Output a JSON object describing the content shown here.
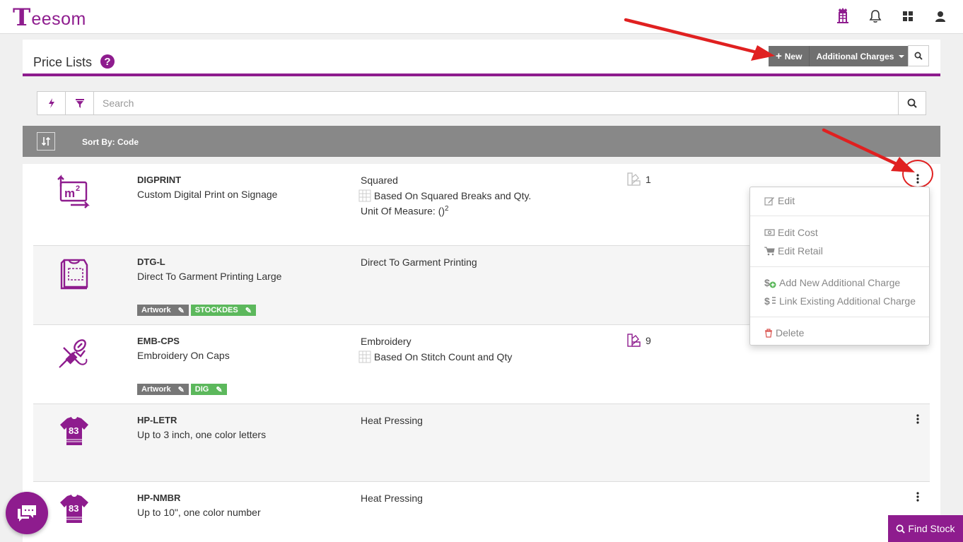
{
  "brand": {
    "logo_initial": "T",
    "logo_rest": "eesom",
    "accent_color": "#8e1c8e"
  },
  "nav": {
    "icons": [
      "castle-icon",
      "bell-icon",
      "grid-icon",
      "user-icon"
    ]
  },
  "header": {
    "title": "Price Lists",
    "help": "?",
    "new_label": "New",
    "charges_label": "Additional Charges"
  },
  "search": {
    "placeholder": "Search"
  },
  "sort": {
    "label": "Sort By: Code"
  },
  "rows": [
    {
      "code": "DIGPRINT",
      "description": "Custom Digital Print on Signage",
      "type": "Squared",
      "basis": "Based On Squared Breaks and Qty.",
      "uom_prefix": "Unit Of Measure: ()",
      "uom_sup": "2",
      "count": "1",
      "icon": "square-meter-icon"
    },
    {
      "code": "DTG-L",
      "description": "Direct To Garment Printing Large",
      "type": "Direct To Garment Printing",
      "tags": [
        "Artwork",
        "STOCKDES"
      ],
      "icon": "garment-print-icon"
    },
    {
      "code": "EMB-CPS",
      "description": "Embroidery On Caps",
      "type": "Embroidery",
      "basis": "Based On Stitch Count and Qty",
      "count": "9",
      "tags": [
        "Artwork",
        "DIG"
      ],
      "icon": "embroidery-needle-icon"
    },
    {
      "code": "HP-LETR",
      "description": "Up to 3 inch, one color letters",
      "type": "Heat Pressing",
      "icon": "jersey-icon",
      "jersey_number": "83"
    },
    {
      "code": "HP-NMBR",
      "description": "Up to 10\", one color number",
      "type": "Heat Pressing",
      "icon": "jersey-icon",
      "jersey_number": "83"
    }
  ],
  "dropdown": {
    "edit": "Edit",
    "edit_cost": "Edit Cost",
    "edit_retail": "Edit Retail",
    "add_new_charge": "Add New Additional Charge",
    "link_existing_charge": "Link Existing Additional Charge",
    "delete": "Delete"
  },
  "find_stock": "Find Stock"
}
